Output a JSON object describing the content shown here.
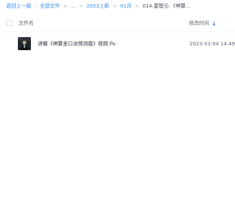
{
  "breadcrumb": {
    "back_label": "返回上一级",
    "all_files_label": "全部文件",
    "ellipsis_label": "...",
    "level_2023_label": "2023上新",
    "level_01_label": "01月",
    "current_label": "014.姜智元-《神算..."
  },
  "table": {
    "col_name": "文件名",
    "col_modified": "修改时间",
    "sort_icon": "sort-arrow-down-icon"
  },
  "files": [
    {
      "name": "讲解《神算金口诀预测盘》视频.flv",
      "modified": "2023-01-04 14:49",
      "icon": "video-thumbnail"
    }
  ],
  "colors": {
    "link": "#2f8cf2",
    "text": "#2b313b",
    "muted": "#5c6370"
  }
}
